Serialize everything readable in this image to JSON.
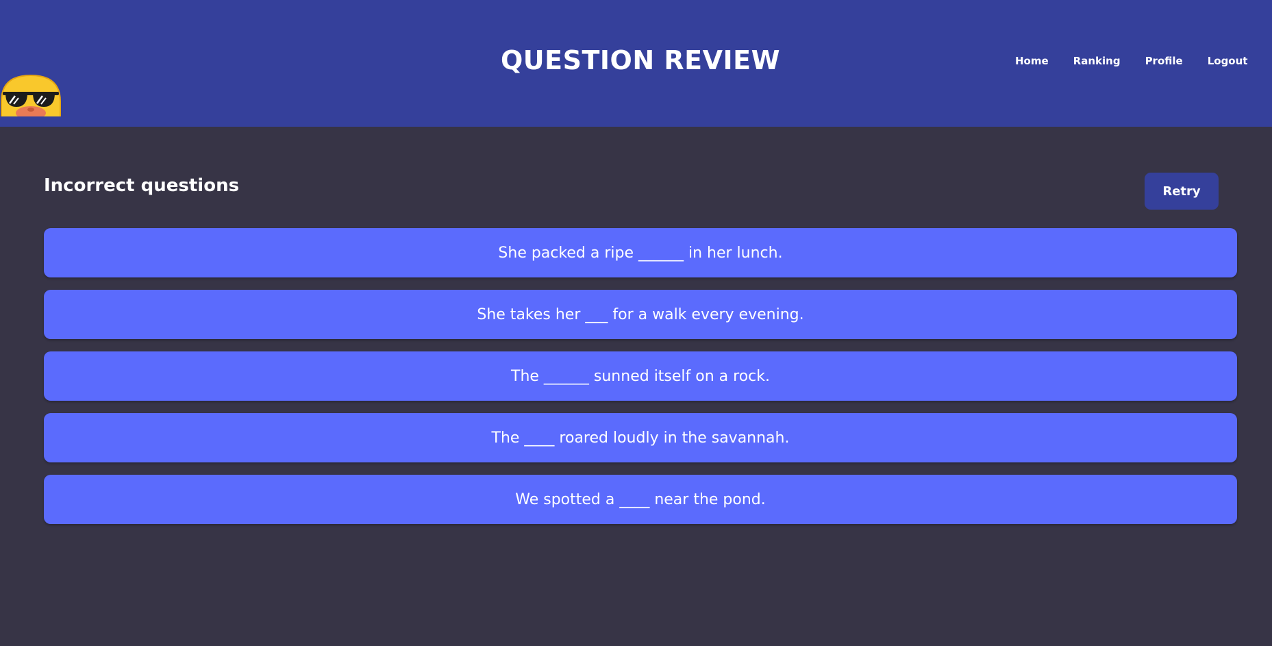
{
  "header": {
    "title": "QUESTION REVIEW",
    "logo": "duck-with-sunglasses-icon",
    "nav": [
      {
        "label": "Home"
      },
      {
        "label": "Ranking"
      },
      {
        "label": "Profile"
      },
      {
        "label": "Logout"
      }
    ]
  },
  "main": {
    "section_title": "Incorrect questions",
    "retry_label": "Retry",
    "questions": [
      {
        "text": "She packed a ripe ______ in her lunch."
      },
      {
        "text": "She takes her ___ for a walk every evening."
      },
      {
        "text": "The ______ sunned itself on a rock."
      },
      {
        "text": "The ____ roared loudly in the savannah."
      },
      {
        "text": "We spotted a ____ near the pond."
      }
    ]
  },
  "colors": {
    "header_bg": "#35409b",
    "page_bg": "#373446",
    "question_bg": "#5b6bfd",
    "retry_bg": "#35409b"
  }
}
